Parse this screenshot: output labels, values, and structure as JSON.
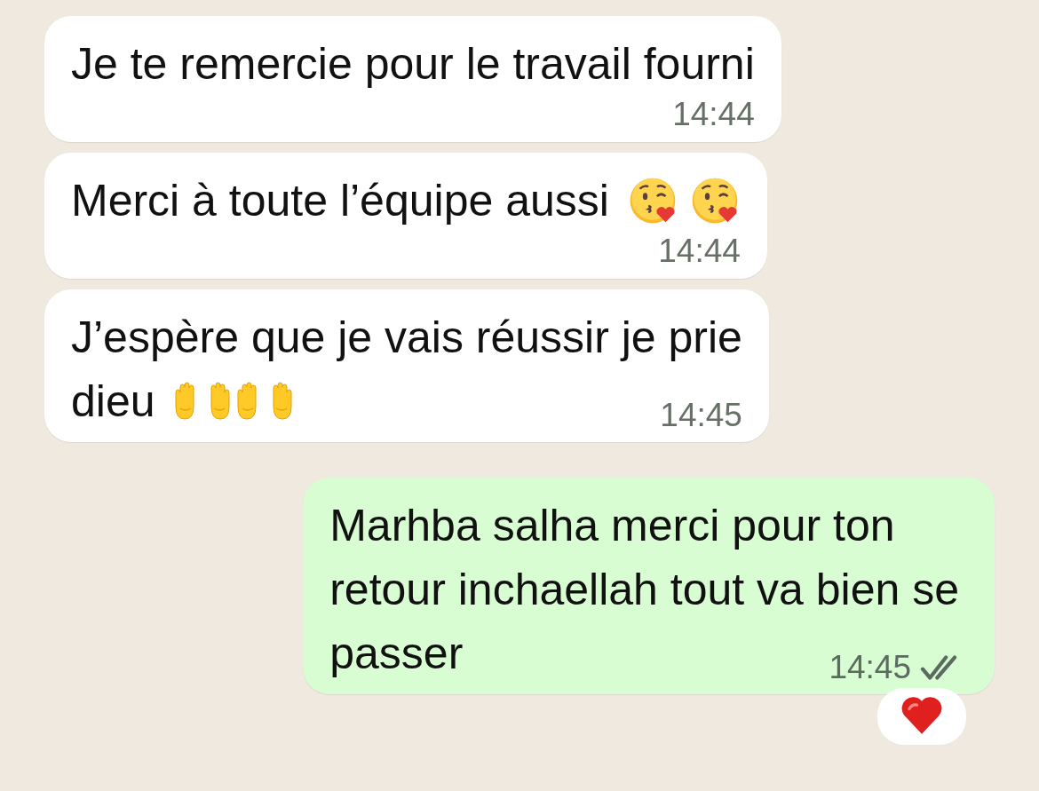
{
  "messages": [
    {
      "kind": "incoming",
      "lines": [
        "Je te remercie pour le travail fourni"
      ],
      "time": "14:44"
    },
    {
      "kind": "incoming",
      "lines": [
        "Merci à toute l’équipe aussi"
      ],
      "emojis": [
        {
          "kind": "kiss-face"
        },
        {
          "kind": "kiss-face"
        }
      ],
      "time": "14:44"
    },
    {
      "kind": "incoming",
      "lines": [
        "J’espère que je vais réussir je prie",
        "dieu"
      ],
      "emojis": [
        {
          "kind": "palms-up"
        },
        {
          "kind": "palms-up"
        }
      ],
      "time": "14:45"
    },
    {
      "kind": "outgoing",
      "lines": [
        "Marhba salha merci pour ton",
        "retour inchaellah tout va bien se",
        "passer"
      ],
      "time": "14:45",
      "read": false,
      "reaction": {
        "kind": "heart"
      }
    }
  ]
}
